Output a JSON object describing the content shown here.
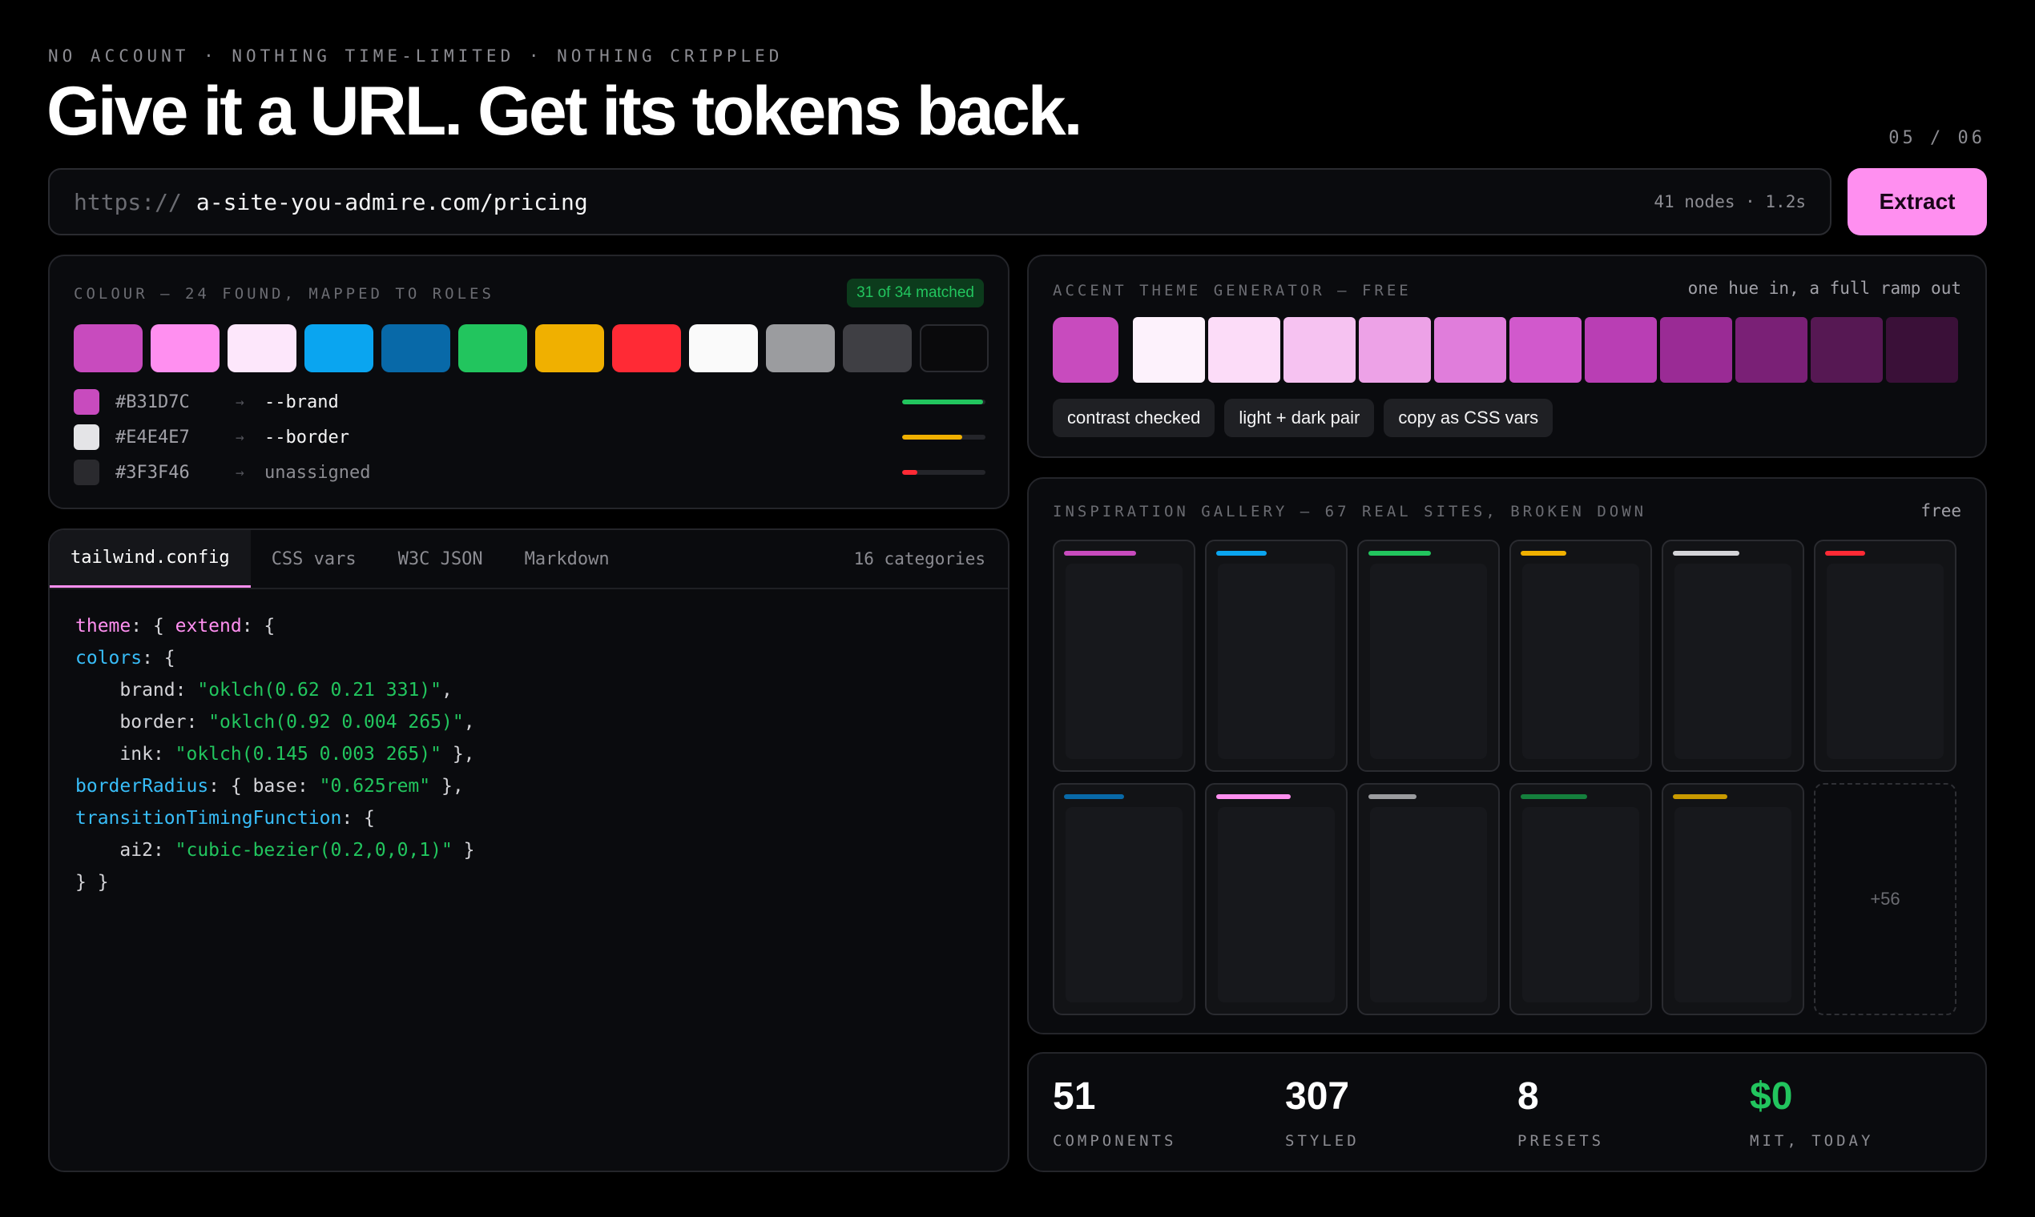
{
  "header": {
    "eyebrow": "NO ACCOUNT · NOTHING TIME-LIMITED · NOTHING CRIPPLED",
    "headline": "Give it a URL. Get its tokens back.",
    "slide_counter": "05 / 06"
  },
  "url_bar": {
    "scheme": "https://",
    "value": "a-site-you-admire.com/pricing",
    "meta": "41 nodes · 1.2s",
    "extract_label": "Extract"
  },
  "colour_panel": {
    "label": "COLOUR — 24 FOUND, MAPPED TO ROLES",
    "badge": "31 of 34 matched",
    "swatches": [
      "#c84bbe",
      "#ff8ff0",
      "#fde7fb",
      "#0aa5f0",
      "#0869a8",
      "#22c55e",
      "#f0b000",
      "#ff2a35",
      "#fafafa",
      "#9b9c9f",
      "#3f3f44",
      "#0a0a0c"
    ],
    "mappings": [
      {
        "hex": "#B31D7C",
        "arrow": "→",
        "role": "--brand",
        "dot": "#c84bbe",
        "bar": 0.97,
        "bar_color": "#22c55e"
      },
      {
        "hex": "#E4E4E7",
        "arrow": "→",
        "role": "--border",
        "dot": "#e4e4e7",
        "bar": 0.72,
        "bar_color": "#f0b000"
      },
      {
        "hex": "#3F3F46",
        "arrow": "→",
        "role": "unassigned",
        "dot": "#2a2a2e",
        "bar": 0.18,
        "bar_color": "#ff2a35"
      }
    ]
  },
  "accent_panel": {
    "label": "ACCENT THEME GENERATOR — FREE",
    "tagline": "one hue in, a full ramp out",
    "main": "#c84bbe",
    "ramp": [
      "#fdf2fc",
      "#fcdcf8",
      "#f6c2f1",
      "#eda2e7",
      "#e07ddb",
      "#d159cc",
      "#b93eb4",
      "#9a2b95",
      "#7a2076",
      "#561853",
      "#3a1038"
    ],
    "pills": [
      "contrast checked",
      "light + dark pair",
      "copy as CSS vars"
    ]
  },
  "code_panel": {
    "tabs": [
      "tailwind.config",
      "CSS vars",
      "W3C JSON",
      "Markdown"
    ],
    "active_tab": 0,
    "meta": "16 categories",
    "code": {
      "l1_k": "theme",
      "l1_p1": ": { ",
      "l1_k2": "extend",
      "l1_p2": ": {",
      "l2_k": "colors",
      "l2_p": ": {",
      "l3_k": "brand",
      "l3_p": ": ",
      "l3_s": "\"oklch(0.62 0.21 331)\"",
      "l3_e": ",",
      "l4_k": "border",
      "l4_p": ": ",
      "l4_s": "\"oklch(0.92 0.004 265)\"",
      "l4_e": ",",
      "l5_k": "ink",
      "l5_p": ": ",
      "l5_s": "\"oklch(0.145 0.003 265)\"",
      "l5_e": " },",
      "l6_k": "borderRadius",
      "l6_p": ": { base: ",
      "l6_s": "\"0.625rem\"",
      "l6_e": " },",
      "l7_k": "transitionTimingFunction",
      "l7_p": ": {",
      "l8_k": "ai2",
      "l8_p": ": ",
      "l8_s": "\"cubic-bezier(0.2,0,0,1)\"",
      "l8_e": " }",
      "l9": "} }"
    }
  },
  "gallery_panel": {
    "label": "INSPIRATION GALLERY — 67 REAL SITES, BROKEN DOWN",
    "tag": "free",
    "cards": [
      {
        "accent": "#c84bbe",
        "line": 0.6
      },
      {
        "accent": "#0aa5f0",
        "line": 0.42
      },
      {
        "accent": "#22c55e",
        "line": 0.52
      },
      {
        "accent": "#f0b000",
        "line": 0.38
      },
      {
        "accent": "#d4d4d8",
        "line": 0.55
      },
      {
        "accent": "#ff2a35",
        "line": 0.33
      },
      {
        "accent": "#0869a8",
        "line": 0.5
      },
      {
        "accent": "#ff8ff0",
        "line": 0.62
      },
      {
        "accent": "#9b9c9f",
        "line": 0.4
      },
      {
        "accent": "#15803d",
        "line": 0.55
      },
      {
        "accent": "#c99a00",
        "line": 0.45
      }
    ],
    "more_label": "+56"
  },
  "stats": [
    {
      "value": "51",
      "label": "COMPONENTS"
    },
    {
      "value": "307",
      "label": "STYLED"
    },
    {
      "value": "8",
      "label": "PRESETS"
    },
    {
      "value": "$0",
      "label": "MIT, TODAY"
    }
  ]
}
